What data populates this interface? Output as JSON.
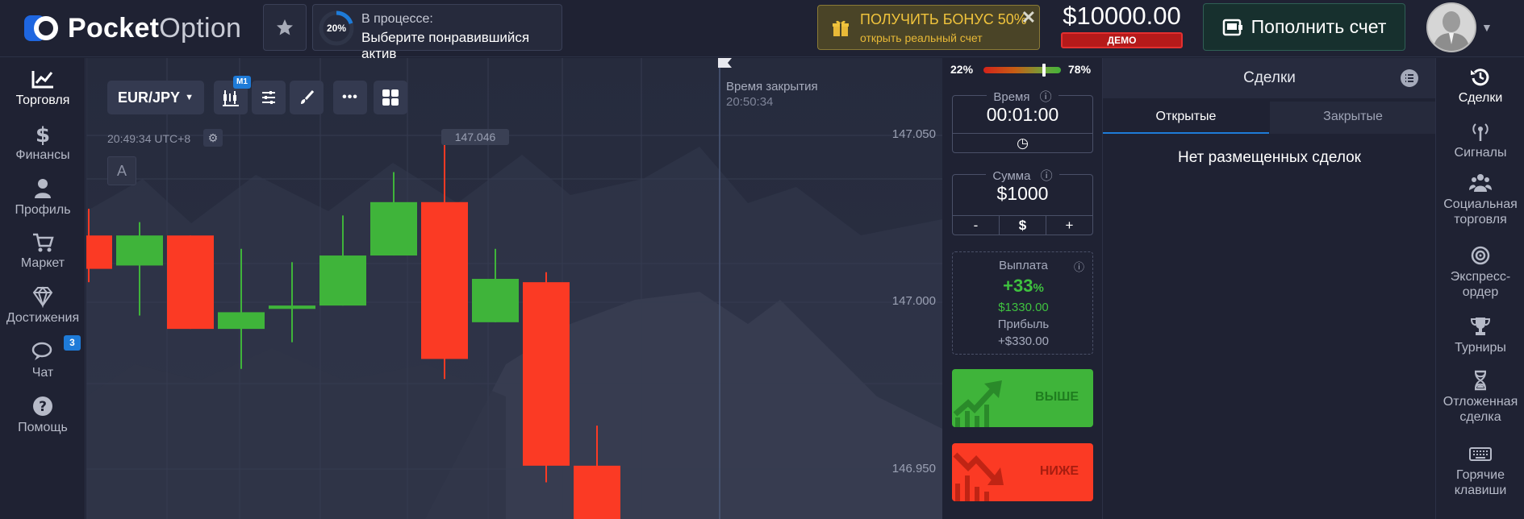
{
  "brand": {
    "name_bold": "Pocket",
    "name_light": "Option"
  },
  "progress": {
    "percent": "20%",
    "line1": "В процессе:",
    "line2": "Выберите понравившийся актив",
    "fraction": 0.2
  },
  "bonus": {
    "title": "ПОЛУЧИТЬ БОНУС 50%",
    "subtitle": "открыть реальный счет",
    "close": "✕"
  },
  "account": {
    "balance": "$10000.00",
    "mode": "ДЕМО"
  },
  "deposit": {
    "label": "Пополнить счет"
  },
  "left_nav": {
    "items": [
      {
        "label": "Торговля",
        "icon": "chart-line-icon",
        "active": true
      },
      {
        "label": "Финансы",
        "icon": "dollar-icon"
      },
      {
        "label": "Профиль",
        "icon": "user-icon"
      },
      {
        "label": "Маркет",
        "icon": "cart-icon"
      },
      {
        "label": "Достижения",
        "icon": "diamond-icon"
      },
      {
        "label": "Чат",
        "icon": "chat-icon",
        "badge": "3"
      },
      {
        "label": "Помощь",
        "icon": "help-icon"
      }
    ]
  },
  "chart": {
    "pair": "EUR/JPY",
    "timeframe": "M1",
    "time": "20:49:34 UTC+8",
    "a_button": "A",
    "current_price": "147.046",
    "axis_labels": [
      "147.050",
      "147.000",
      "146.950"
    ],
    "close_label": "Время закрытия",
    "close_time": "20:50:34"
  },
  "trade": {
    "sentiment_sell": "22%",
    "sentiment_buy": "78%",
    "sentiment_buy_fraction": 0.78,
    "time_label": "Время",
    "time_value": "00:01:00",
    "amount_label": "Сумма",
    "amount_value": "$1000",
    "amount_minus": "-",
    "amount_currency": "$",
    "amount_plus": "+",
    "payout_label": "Выплата",
    "payout_percent": "+33",
    "payout_percent_sign": "%",
    "payout_total": "$1330.00",
    "profit_label": "Прибыль",
    "profit_value": "+$330.00",
    "up_label": "ВЫШЕ",
    "down_label": "НИЖЕ"
  },
  "deals": {
    "title": "Сделки",
    "tab_open": "Открытые",
    "tab_closed": "Закрытые",
    "empty": "Нет размещенных сделок"
  },
  "right_nav": {
    "items": [
      {
        "label": "Сделки",
        "icon": "history-icon",
        "active": true
      },
      {
        "label": "Сигналы",
        "icon": "signal-icon"
      },
      {
        "label": "Социальная торговля",
        "icon": "people-icon"
      },
      {
        "label": "Экспресс-ордер",
        "icon": "target-icon"
      },
      {
        "label": "Турниры",
        "icon": "trophy-icon"
      },
      {
        "label": "Отложенная сделка",
        "icon": "hourglass-icon"
      },
      {
        "label": "Горячие клавиши",
        "icon": "keyboard-icon"
      }
    ]
  },
  "colors": {
    "up": "#3fb43a",
    "down": "#fb3a24",
    "accent": "#1e7bd8",
    "bonus": "#f0c33c",
    "demo": "#b51a1a"
  },
  "candles": [
    {
      "o": 147.02,
      "c": 147.01,
      "h": 147.028,
      "l": 147.006
    },
    {
      "o": 147.011,
      "c": 147.02,
      "h": 147.024,
      "l": 146.996
    },
    {
      "o": 147.02,
      "c": 146.992,
      "h": 147.02,
      "l": 146.992
    },
    {
      "o": 146.992,
      "c": 146.997,
      "h": 147.016,
      "l": 146.98
    },
    {
      "o": 146.998,
      "c": 146.999,
      "h": 147.012,
      "l": 146.988
    },
    {
      "o": 146.999,
      "c": 147.014,
      "h": 147.026,
      "l": 146.999
    },
    {
      "o": 147.014,
      "c": 147.03,
      "h": 147.039,
      "l": 147.014
    },
    {
      "o": 147.03,
      "c": 146.983,
      "h": 147.048,
      "l": 146.977
    },
    {
      "o": 146.994,
      "c": 147.007,
      "h": 147.016,
      "l": 146.994
    },
    {
      "o": 147.006,
      "c": 146.951,
      "h": 147.009,
      "l": 146.946
    },
    {
      "o": 146.951,
      "c": 146.935,
      "h": 146.963,
      "l": 146.93
    }
  ]
}
